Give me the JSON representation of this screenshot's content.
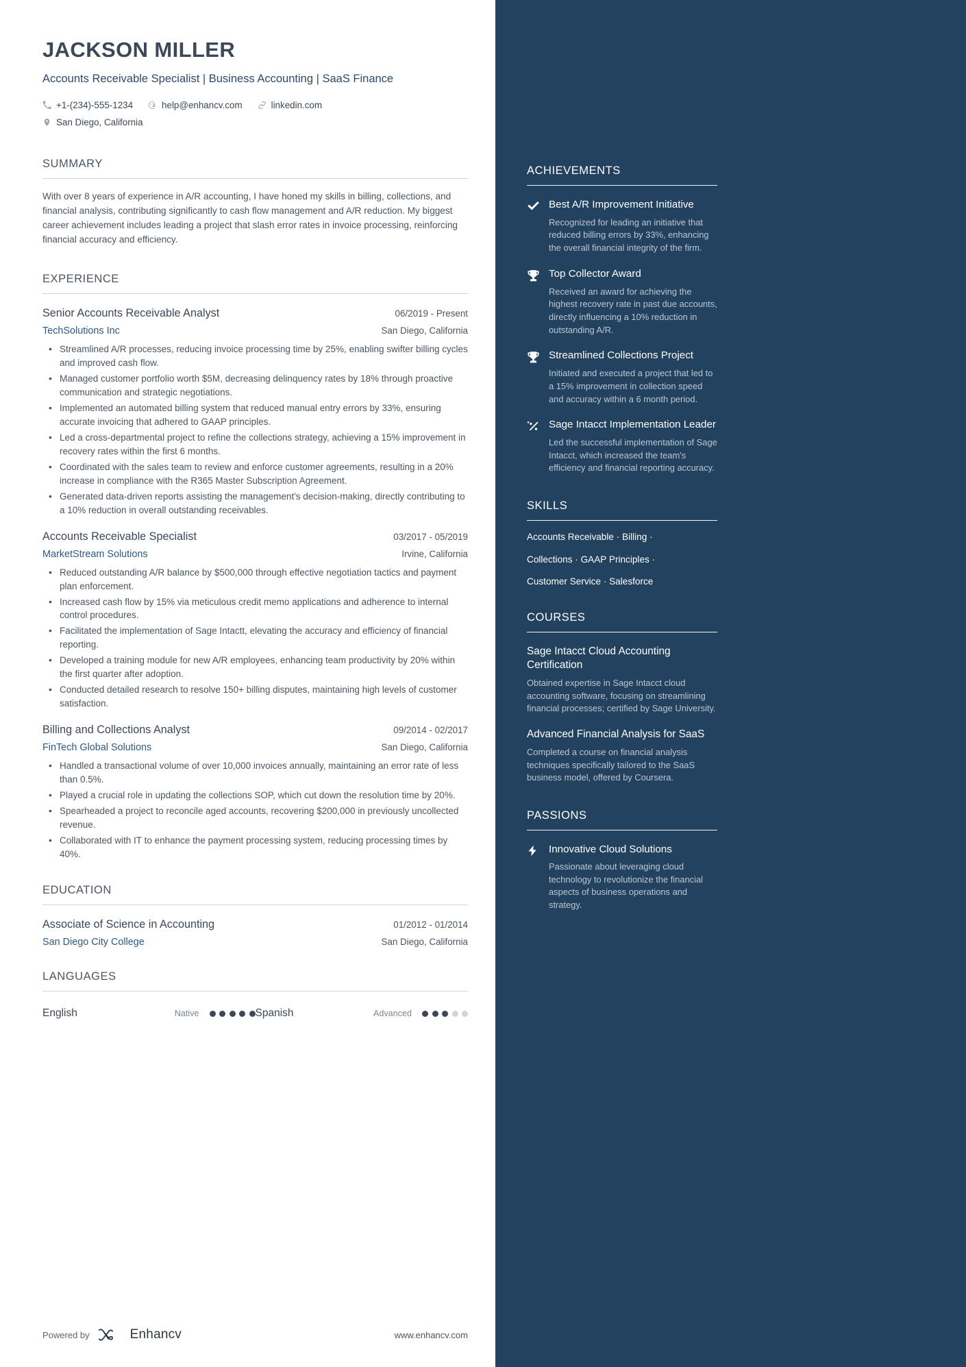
{
  "header": {
    "name": "JACKSON MILLER",
    "headline": "Accounts Receivable Specialist | Business Accounting | SaaS Finance",
    "contacts": {
      "phone": "+1-(234)-555-1234",
      "email": "help@enhancv.com",
      "linkedin": "linkedin.com",
      "location": "San Diego, California"
    }
  },
  "summary": {
    "title": "SUMMARY",
    "text": "With over 8 years of experience in A/R accounting, I have honed my skills in billing, collections, and financial analysis, contributing significantly to cash flow management and A/R reduction. My biggest career achievement includes leading a project that slash error rates in invoice processing, reinforcing financial accuracy and efficiency."
  },
  "experience": {
    "title": "EXPERIENCE",
    "entries": [
      {
        "role": "Senior Accounts Receivable Analyst",
        "date": "06/2019 - Present",
        "company": "TechSolutions Inc",
        "location": "San Diego, California",
        "bullets": [
          "Streamlined A/R processes, reducing invoice processing time by 25%, enabling swifter billing cycles and improved cash flow.",
          "Managed customer portfolio worth $5M, decreasing delinquency rates by 18% through proactive communication and strategic negotiations.",
          "Implemented an automated billing system that reduced manual entry errors by 33%, ensuring accurate invoicing that adhered to GAAP principles.",
          "Led a cross-departmental project to refine the collections strategy, achieving a 15% improvement in recovery rates within the first 6 months.",
          "Coordinated with the sales team to review and enforce customer agreements, resulting in a 20% increase in compliance with the R365 Master Subscription Agreement.",
          "Generated data-driven reports assisting the management's decision-making, directly contributing to a 10% reduction in overall outstanding receivables."
        ]
      },
      {
        "role": "Accounts Receivable Specialist",
        "date": "03/2017 - 05/2019",
        "company": "MarketStream Solutions",
        "location": "Irvine, California",
        "bullets": [
          "Reduced outstanding A/R balance by $500,000 through effective negotiation tactics and payment plan enforcement.",
          "Increased cash flow by 15% via meticulous credit memo applications and adherence to internal control procedures.",
          "Facilitated the implementation of Sage Intactt, elevating the accuracy and efficiency of financial reporting.",
          "Developed a training module for new A/R employees, enhancing team productivity by 20% within the first quarter after adoption.",
          "Conducted detailed research to resolve 150+ billing disputes, maintaining high levels of customer satisfaction."
        ]
      },
      {
        "role": "Billing and Collections Analyst",
        "date": "09/2014 - 02/2017",
        "company": "FinTech Global Solutions",
        "location": "San Diego, California",
        "bullets": [
          "Handled a transactional volume of over 10,000 invoices annually, maintaining an error rate of less than 0.5%.",
          "Played a crucial role in updating the collections SOP, which cut down the resolution time by 20%.",
          "Spearheaded a project to reconcile aged accounts, recovering $200,000 in previously uncollected revenue.",
          "Collaborated with IT to enhance the payment processing system, reducing processing times by 40%."
        ]
      }
    ]
  },
  "education": {
    "title": "EDUCATION",
    "entries": [
      {
        "degree": "Associate of Science in Accounting",
        "date": "01/2012 - 01/2014",
        "school": "San Diego City College",
        "location": "San Diego, California"
      }
    ]
  },
  "languages": {
    "title": "LANGUAGES",
    "items": [
      {
        "name": "English",
        "level": "Native",
        "filled": 5,
        "total": 5
      },
      {
        "name": "Spanish",
        "level": "Advanced",
        "filled": 3,
        "total": 5
      }
    ]
  },
  "footer": {
    "powered_by": "Powered by",
    "brand": "Enhancv",
    "website": "www.enhancv.com"
  },
  "sidebar": {
    "achievements": {
      "title": "ACHIEVEMENTS",
      "items": [
        {
          "icon": "check-icon",
          "title": "Best A/R Improvement Initiative",
          "desc": "Recognized for leading an initiative that reduced billing errors by 33%, enhancing the overall financial integrity of the firm."
        },
        {
          "icon": "trophy-icon",
          "title": "Top Collector Award",
          "desc": "Received an award for achieving the highest recovery rate in past due accounts, directly influencing a 10% reduction in outstanding A/R."
        },
        {
          "icon": "trophy-icon",
          "title": "Streamlined Collections Project",
          "desc": "Initiated and executed a project that led to a 15% improvement in collection speed and accuracy within a 6 month period."
        },
        {
          "icon": "sparkle-chart-icon",
          "title": "Sage Intacct Implementation Leader",
          "desc": "Led the successful implementation of Sage Intacct, which increased the team's efficiency and financial reporting accuracy."
        }
      ]
    },
    "skills": {
      "title": "SKILLS",
      "lines": [
        "Accounts Receivable · Billing ·",
        "Collections · GAAP Principles ·",
        "Customer Service · Salesforce"
      ]
    },
    "courses": {
      "title": "COURSES",
      "items": [
        {
          "title": "Sage Intacct Cloud Accounting Certification",
          "desc": "Obtained expertise in Sage Intacct cloud accounting software, focusing on streamlining financial processes; certified by Sage University."
        },
        {
          "title": "Advanced Financial Analysis for SaaS",
          "desc": "Completed a course on financial analysis techniques specifically tailored to the SaaS business model, offered by Coursera."
        }
      ]
    },
    "passions": {
      "title": "PASSIONS",
      "items": [
        {
          "icon": "bolt-icon",
          "title": "Innovative Cloud Solutions",
          "desc": "Passionate about leveraging cloud technology to revolutionize the financial aspects of business operations and strategy."
        }
      ]
    }
  },
  "colors": {
    "sidebar_bg": "#23425f",
    "accent_link": "#2d5986",
    "text": "#3c4857"
  }
}
